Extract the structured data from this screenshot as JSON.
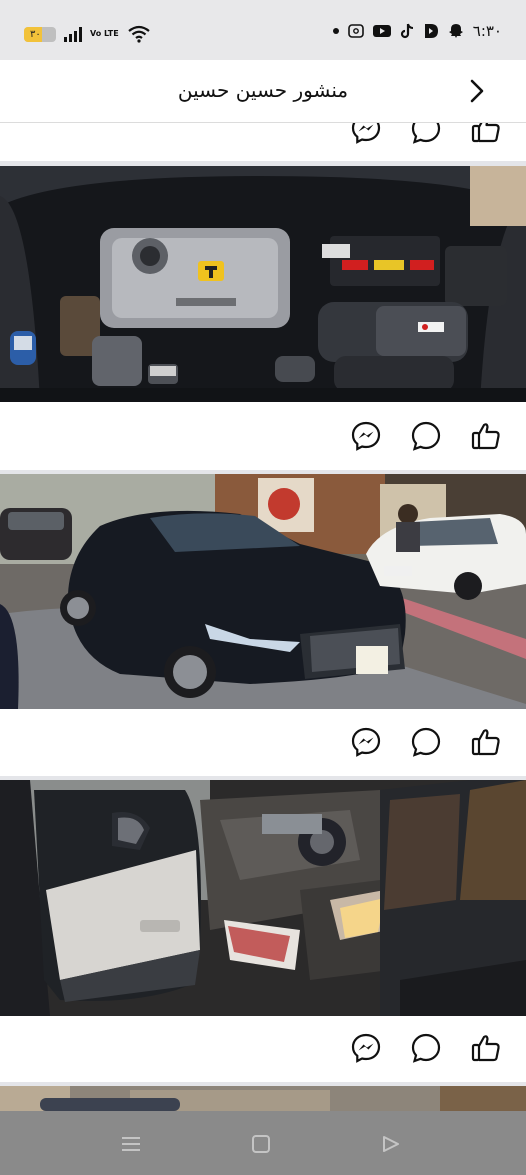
{
  "status_bar": {
    "time": "٦:٣٠",
    "battery": "٣٠",
    "network": "Vo LTE"
  },
  "header": {
    "title": "منشور حسين حسين"
  },
  "icons": {
    "back": "chevron-right-icon",
    "messenger": "messenger-icon",
    "comment": "comment-icon",
    "like": "thumbs-up-icon"
  },
  "photos": [
    {
      "description": "engine bay"
    },
    {
      "description": "black sedan at car wash"
    },
    {
      "description": "interior open door"
    },
    {
      "description": "partial photo"
    }
  ],
  "colors": {
    "header_bg": "#ffffff",
    "separator": "#e4e5e9",
    "navbar": "#8a8a8a"
  }
}
